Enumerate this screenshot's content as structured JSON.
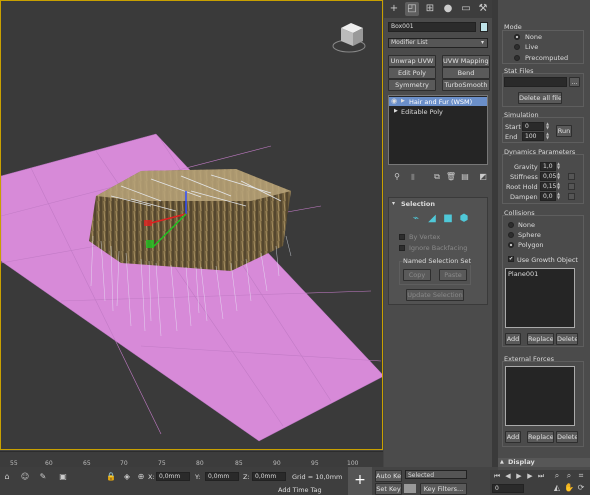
{
  "viewport": {
    "viewcube_label": "viewcube"
  },
  "timeline": {
    "ticks": [
      "55",
      "60",
      "65",
      "70",
      "75",
      "80",
      "85",
      "90",
      "95",
      "100"
    ]
  },
  "statusbar": {
    "x_label": "X:",
    "x_value": "0,0mm",
    "y_label": "Y:",
    "y_value": "0,0mm",
    "z_label": "Z:",
    "z_value": "0,0mm",
    "grid": "Grid = 10,0mm",
    "add_time_tag": "Add Time Tag",
    "auto_key": "Auto Key",
    "set_key": "Set Key",
    "selected": "Selected",
    "key_filters": "Key Filters...",
    "frame": "0"
  },
  "command_panel": {
    "object_name": "Box001",
    "modifier_list": "Modifier List",
    "buttons": [
      "Unwrap UVW",
      "UVW Mapping Clear",
      "Edit Poly",
      "Bend",
      "Symmetry",
      "TurboSmooth"
    ],
    "stack": [
      "Hair and Fur (WSM)",
      "Editable Poly"
    ],
    "selection_title": "Selection",
    "by_vertex": "By Vertex",
    "ignore_backfacing": "Ignore Backfacing",
    "named_selection_set": "Named Selection Set",
    "copy": "Copy",
    "paste": "Paste",
    "update_selection": "Update Selection"
  },
  "dynamics_panel": {
    "mode_title": "Mode",
    "mode_options": [
      "None",
      "Live",
      "Precomputed"
    ],
    "stat_files_title": "Stat Files",
    "stat_browse": "...",
    "delete_all_files": "Delete all files",
    "simulation_title": "Simulation",
    "start_label": "Start",
    "start_value": "0",
    "end_label": "End",
    "end_value": "100",
    "run": "Run",
    "dyn_params_title": "Dynamics Parameters",
    "gravity_label": "Gravity",
    "gravity_value": "1,0",
    "stiffness_label": "Stiffness",
    "stiffness_value": "0,05",
    "roothold_label": "Root Hold",
    "roothold_value": "0,15",
    "dampen_label": "Dampen",
    "dampen_value": "0,0",
    "collisions_title": "Collisions",
    "collision_options": [
      "None",
      "Sphere",
      "Polygon"
    ],
    "use_growth_object": "Use Growth Object",
    "collision_list": [
      "Plane001"
    ],
    "add": "Add",
    "replace": "Replace",
    "delete": "Delete",
    "external_forces_title": "External Forces",
    "display_title": "Display"
  },
  "colors": {
    "viewport_border": "#c8a000",
    "plane": "#d78ad8",
    "selected_item": "#6b8fc9"
  }
}
